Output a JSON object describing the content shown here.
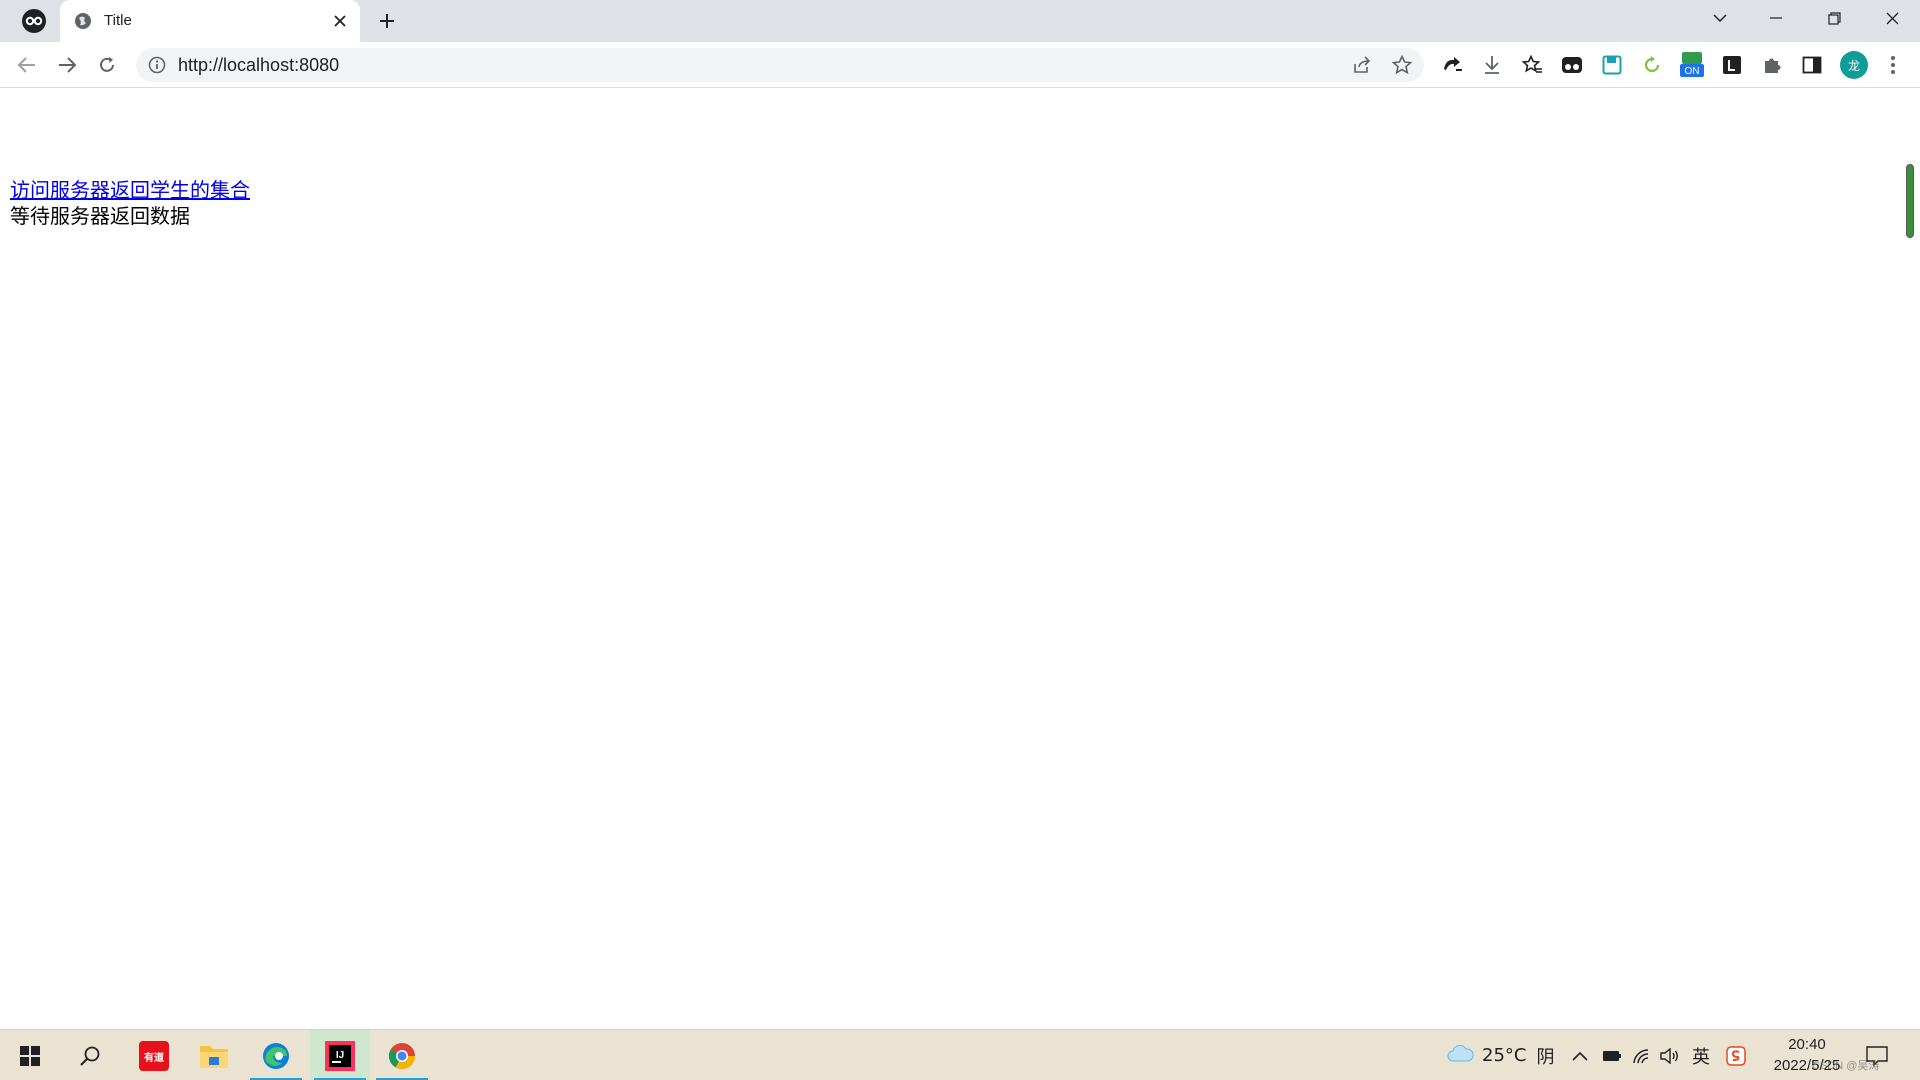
{
  "browser": {
    "tab": {
      "title": "Title"
    },
    "address_bar": {
      "url": "http://localhost:8080"
    },
    "profile_initial": "龙",
    "extension_badge": "ON"
  },
  "page": {
    "link_text": "访问服务器返回学生的集合",
    "status_text": "等待服务器返回数据"
  },
  "taskbar": {
    "items": [
      "start-menu",
      "search",
      "youdao-dictionary",
      "file-explorer",
      "edge",
      "intellij-idea",
      "chrome"
    ],
    "youdao_label": "有道",
    "weather": {
      "temperature": "25°C",
      "condition": "阴"
    },
    "ime": "英",
    "clock": {
      "time": "20:40",
      "date": "2022/5/25"
    },
    "watermark": "CSDN @吴涛"
  },
  "colors": {
    "link": "#0000ee",
    "tabstrip": "#dee1e6",
    "taskbar": "#eae3d2",
    "avatar": "#0f9d9a"
  }
}
